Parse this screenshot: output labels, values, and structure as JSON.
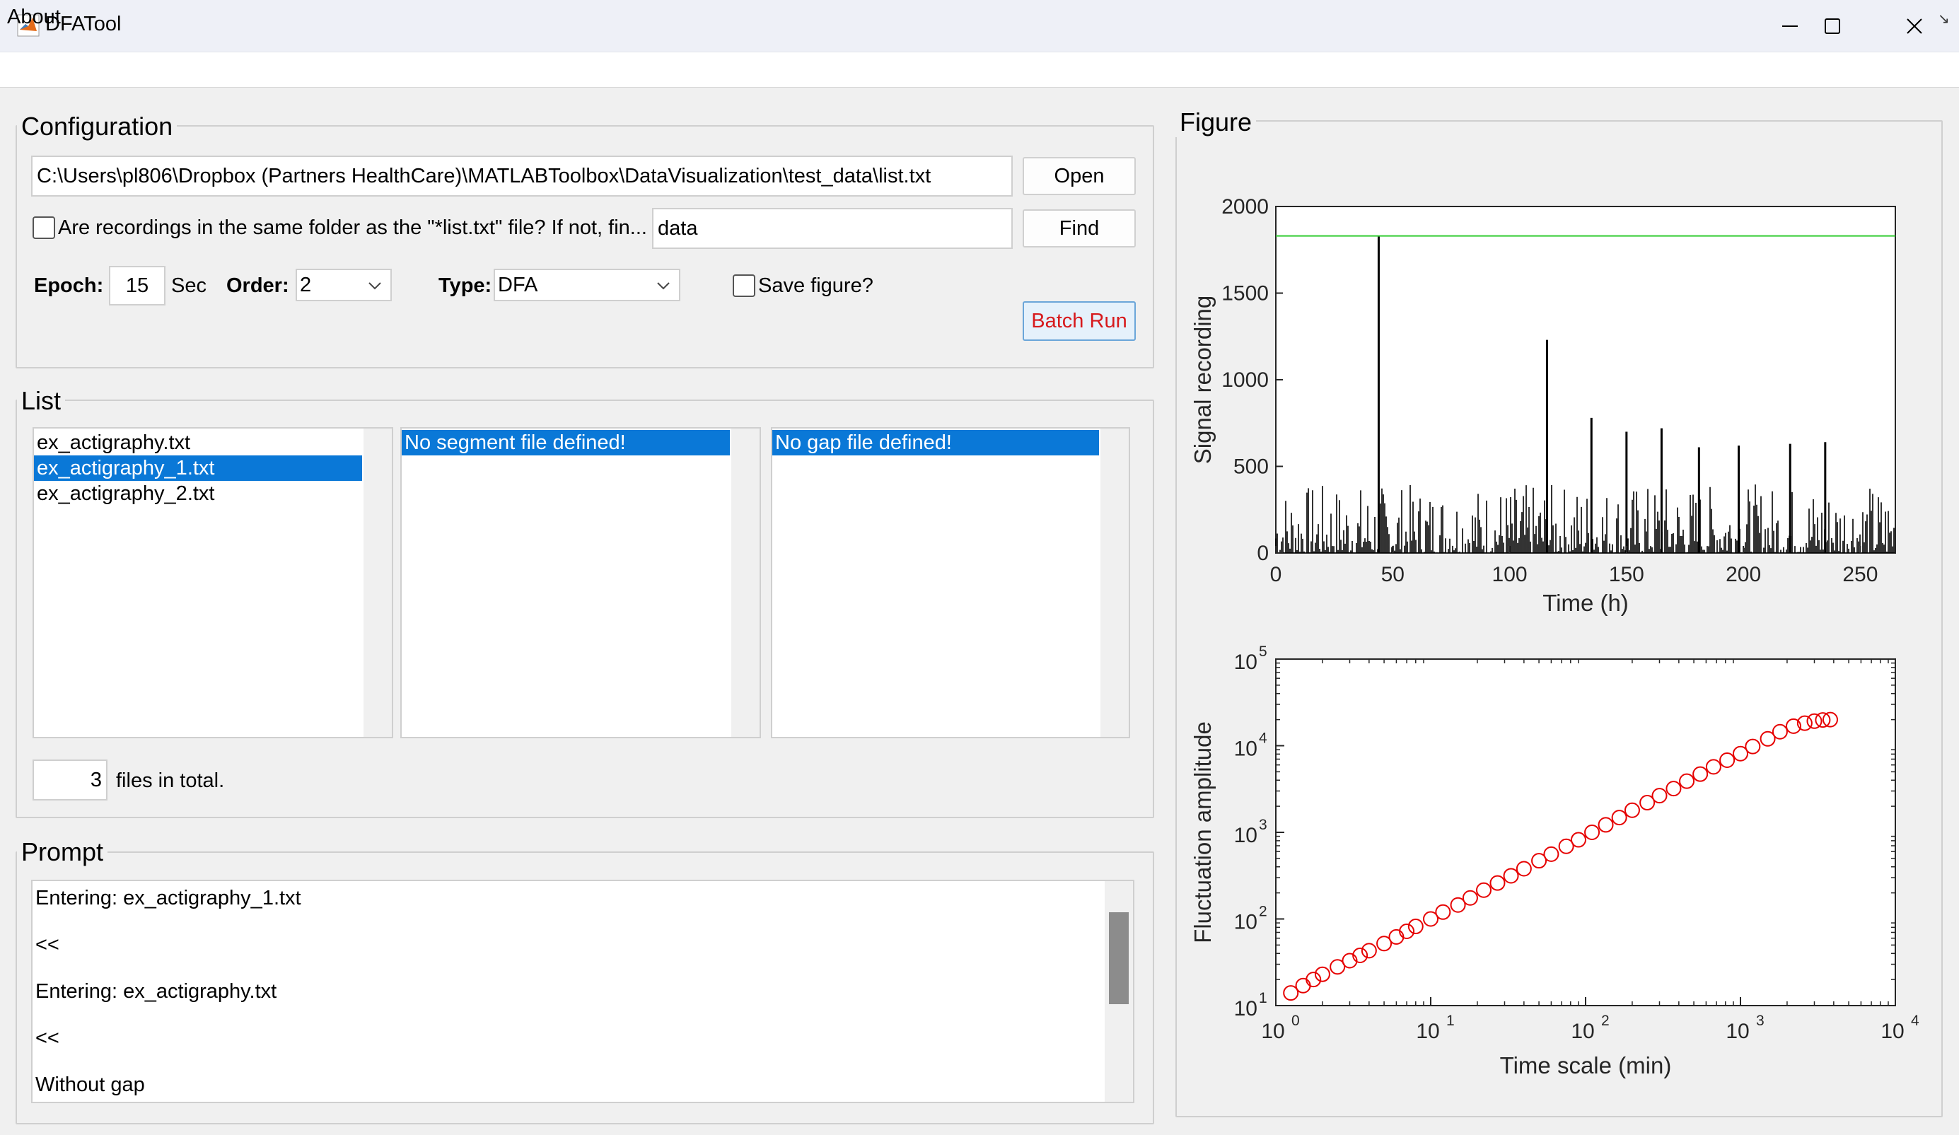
{
  "window": {
    "title": "DFATool"
  },
  "menu": {
    "about": "About"
  },
  "config": {
    "title": "Configuration",
    "list_path": "C:\\Users\\pl806\\Dropbox (Partners HealthCare)\\MATLABToolbox\\DataVisualization\\test_data\\list.txt",
    "open_label": "Open",
    "same_folder_label": "Are recordings in the same folder as the \"*list.txt\" file? If not, fin...",
    "same_folder_checked": false,
    "folder_value": "data",
    "find_label": "Find",
    "epoch_label": "Epoch:",
    "epoch_value": "15",
    "epoch_unit": "Sec",
    "order_label": "Order:",
    "order_value": "2",
    "type_label": "Type:",
    "type_value": "DFA",
    "save_figure_label": "Save figure?",
    "save_figure_checked": false,
    "batch_run_label": "Batch Run",
    "batch_run_color": "#d7191c"
  },
  "list": {
    "title": "List",
    "files": [
      "ex_actigraphy.txt",
      "ex_actigraphy_1.txt",
      "ex_actigraphy_2.txt"
    ],
    "selected_file": "ex_actigraphy_1.txt",
    "segments": [
      "No segment file defined!"
    ],
    "gaps": [
      "No gap file defined!"
    ],
    "count_value": "3",
    "count_label": "files in total."
  },
  "prompt": {
    "title": "Prompt",
    "lines": [
      "Entering: ex_actigraphy_1.txt",
      "<<",
      "Entering: ex_actigraphy.txt",
      "<<",
      "Without gap"
    ]
  },
  "figure": {
    "title": "Figure"
  },
  "chart_data": [
    {
      "type": "line",
      "xlabel": "Time (h)",
      "ylabel": "Signal recording",
      "xlim": [
        0,
        265
      ],
      "ylim": [
        0,
        2000
      ],
      "xticks": [
        "0",
        "50",
        "100",
        "150",
        "200",
        "250"
      ],
      "yticks": [
        "0",
        "500",
        "1000",
        "1500",
        "2000"
      ],
      "series": [
        {
          "values_description_free": true,
          "x": [
            0,
            265
          ],
          "y": [
            1830,
            1830
          ],
          "color": "#33cc33"
        }
      ],
      "spikes": [
        {
          "x": 44,
          "y": 1830
        },
        {
          "x": 116,
          "y": 1230
        },
        {
          "x": 135,
          "y": 780
        },
        {
          "x": 150,
          "y": 700
        },
        {
          "x": 165,
          "y": 720
        },
        {
          "x": 181,
          "y": 610
        },
        {
          "x": 198,
          "y": 620
        },
        {
          "x": 220,
          "y": 630
        },
        {
          "x": 235,
          "y": 640
        }
      ],
      "baseline_max": 400,
      "signal_color": "#000000"
    },
    {
      "type": "scatter",
      "xlabel": "Time scale (min)",
      "ylabel": "Fluctuation amplitude",
      "xscale": "log",
      "yscale": "log",
      "xlim": [
        1,
        10000
      ],
      "ylim": [
        10,
        100000
      ],
      "x_tick_exponents": [
        0,
        1,
        2,
        3,
        4
      ],
      "y_tick_exponents": [
        1,
        2,
        3,
        4,
        5
      ],
      "marker_color": "#e60000",
      "x": [
        1.25,
        1.5,
        1.75,
        2,
        2.5,
        3,
        3.5,
        4,
        5,
        6,
        7,
        8,
        10,
        12,
        15,
        18,
        22,
        27,
        33,
        40,
        50,
        60,
        75,
        90,
        110,
        135,
        165,
        200,
        250,
        300,
        370,
        450,
        550,
        670,
        820,
        1000,
        1200,
        1500,
        1800,
        2200,
        2600,
        3000,
        3400,
        3800
      ],
      "y": [
        14,
        17,
        20,
        23,
        28,
        33,
        38,
        43,
        52,
        62,
        72,
        82,
        100,
        120,
        145,
        175,
        215,
        260,
        315,
        380,
        470,
        560,
        690,
        820,
        1000,
        1220,
        1480,
        1800,
        2200,
        2650,
        3200,
        3900,
        4700,
        5700,
        6800,
        8100,
        9800,
        12000,
        14500,
        16800,
        18200,
        19200,
        19800,
        20000
      ]
    }
  ]
}
